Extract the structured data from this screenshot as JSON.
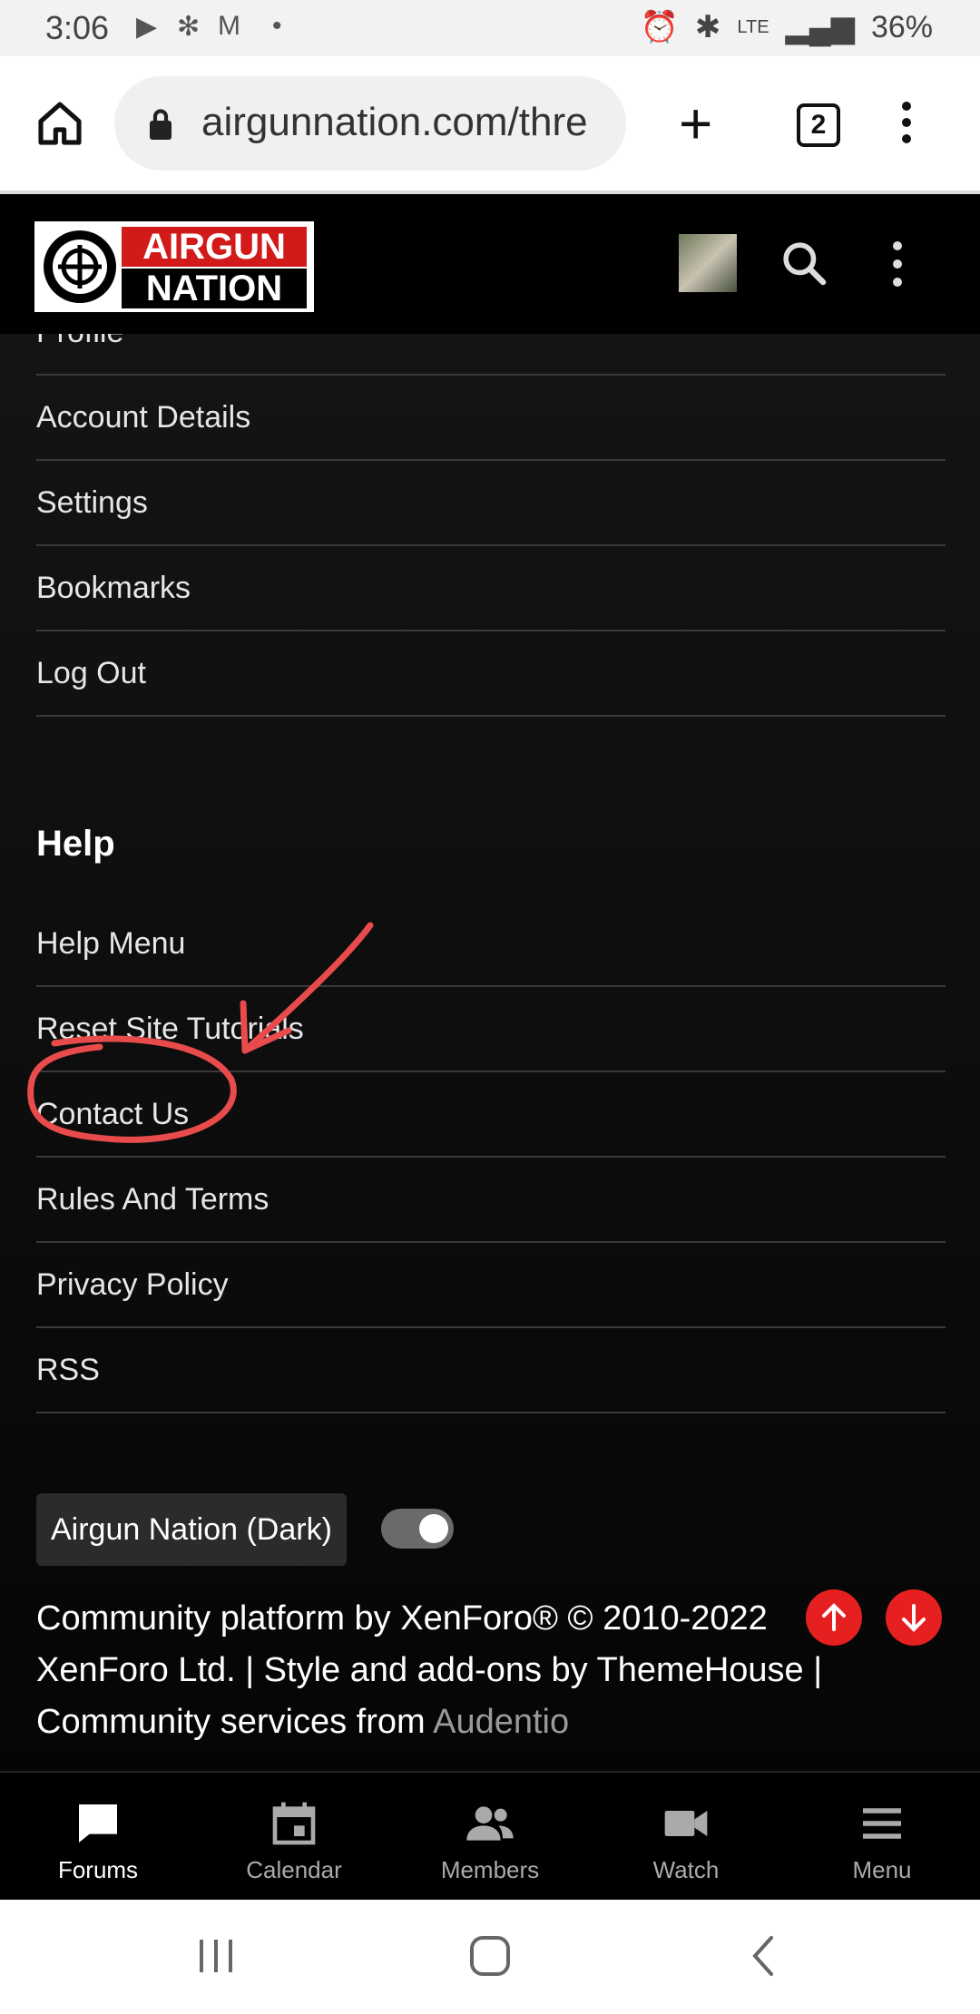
{
  "status": {
    "time": "3:06",
    "battery": "36%",
    "network": "LTE"
  },
  "browser": {
    "url": "airgunnation.com/thre",
    "tab_count": "2"
  },
  "site": {
    "logo_top": "AIRGUN",
    "logo_bottom": "NATION"
  },
  "menu": {
    "partial_item": "Profile",
    "account_items": [
      "Account Details",
      "Settings",
      "Bookmarks",
      "Log Out"
    ],
    "help_heading": "Help",
    "help_items": [
      "Help Menu",
      "Reset Site Tutorials",
      "Contact Us",
      "Rules And Terms",
      "Privacy Policy",
      "RSS"
    ]
  },
  "theme": {
    "label": "Airgun Nation (Dark)",
    "enabled": true
  },
  "footer": {
    "line1": "Community platform by XenForo® © 2010-2022",
    "line2": "XenForo Ltd. | Style and add-ons by ThemeHouse |",
    "line3_prefix": "Community services from",
    "line3_link": "Audentio"
  },
  "bottom_nav": [
    {
      "label": "Forums",
      "icon": "chat-bubble-icon",
      "active": true
    },
    {
      "label": "Calendar",
      "icon": "calendar-icon"
    },
    {
      "label": "Members",
      "icon": "people-icon"
    },
    {
      "label": "Watch",
      "icon": "video-camera-icon"
    },
    {
      "label": "Menu",
      "icon": "hamburger-icon"
    }
  ],
  "colors": {
    "accent_red": "#e62020",
    "annotation": "#e84b4b",
    "background": "#000000"
  }
}
